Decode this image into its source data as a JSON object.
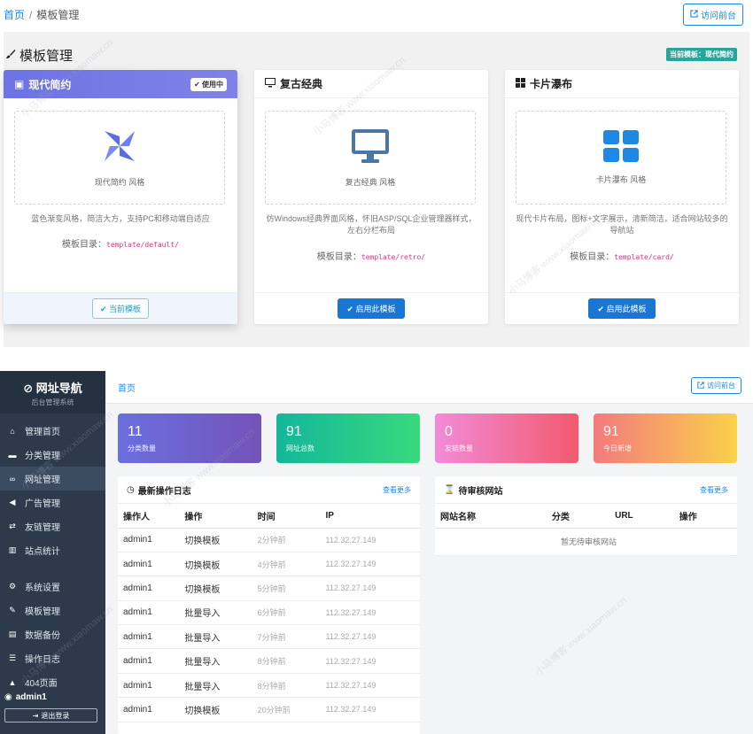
{
  "top": {
    "breadcrumb": {
      "home": "首页",
      "sep": "/",
      "current": "模板管理"
    },
    "visit_label": "访问前台",
    "title": "模板管理",
    "current_badge": "当前模板：现代简约",
    "cards": [
      {
        "name": "现代简约",
        "badge": "使用中",
        "preview_label": "现代简约 风格",
        "desc": "蓝色渐变风格，简洁大方，支持PC和移动端自适应",
        "dir_label": "模板目录：",
        "dir": "template/default/",
        "button": "当前模板",
        "icon": "pinwheel-icon",
        "accent": "#5b6ee1"
      },
      {
        "name": "复古经典",
        "preview_label": "复古经典 风格",
        "desc": "仿Windows经典界面风格，怀旧ASP/SQL企业管理器样式，左右分栏布局",
        "dir_label": "模板目录：",
        "dir": "template/retro/",
        "button": "启用此模板",
        "icon": "monitor-icon",
        "accent": "#4a76a8"
      },
      {
        "name": "卡片瀑布",
        "preview_label": "卡片瀑布 风格",
        "desc": "现代卡片布局，图标+文字展示，清新简洁，适合网站较多的导航站",
        "dir_label": "模板目录：",
        "dir": "template/card/",
        "button": "启用此模板",
        "icon": "grid-icon",
        "accent": "#1e88e5"
      }
    ]
  },
  "admin": {
    "brand": {
      "title": "网址导航",
      "subtitle": "后台管理系统"
    },
    "nav": [
      {
        "label": "管理首页",
        "icon": "home-icon"
      },
      {
        "label": "分类管理",
        "icon": "folder-icon"
      },
      {
        "label": "网址管理",
        "icon": "link-icon",
        "active": true
      },
      {
        "label": "广告管理",
        "icon": "megaphone-icon"
      },
      {
        "label": "友链管理",
        "icon": "handshake-icon"
      },
      {
        "label": "站点统计",
        "icon": "chart-icon"
      },
      {
        "label": "系统设置",
        "icon": "gear-icon",
        "gap": true
      },
      {
        "label": "模板管理",
        "icon": "brush-icon"
      },
      {
        "label": "数据备份",
        "icon": "database-icon"
      },
      {
        "label": "操作日志",
        "icon": "list-icon"
      },
      {
        "label": "404页面",
        "icon": "warning-icon"
      }
    ],
    "user": "admin1",
    "logout": "退出登录",
    "breadcrumb": "首页",
    "visit_label": "访问前台",
    "stats": [
      {
        "value": "11",
        "label": "分类数量"
      },
      {
        "value": "91",
        "label": "网址总数"
      },
      {
        "value": "0",
        "label": "友链数量"
      },
      {
        "value": "91",
        "label": "今日新增"
      }
    ],
    "log_panel": {
      "title": "最新操作日志",
      "more": "查看更多",
      "columns": [
        "操作人",
        "操作",
        "时间",
        "IP"
      ],
      "rows": [
        [
          "admin1",
          "切换模板",
          "2分钟前",
          "112.32.27.149"
        ],
        [
          "admin1",
          "切换模板",
          "4分钟前",
          "112.32.27.149"
        ],
        [
          "admin1",
          "切换模板",
          "5分钟前",
          "112.32.27.149"
        ],
        [
          "admin1",
          "批量导入",
          "6分钟前",
          "112.32.27.149"
        ],
        [
          "admin1",
          "批量导入",
          "7分钟前",
          "112.32.27.149"
        ],
        [
          "admin1",
          "批量导入",
          "8分钟前",
          "112.32.27.149"
        ],
        [
          "admin1",
          "批量导入",
          "8分钟前",
          "112.32.27.149"
        ],
        [
          "admin1",
          "切换模板",
          "20分钟前",
          "112.32.27.149"
        ]
      ]
    },
    "review_panel": {
      "title": "待审核网站",
      "more": "查看更多",
      "columns": [
        "网站名称",
        "分类",
        "URL",
        "操作"
      ],
      "empty": "暂无待审核网站"
    }
  },
  "watermark": "小马博客 www.xiaomaw.cn"
}
